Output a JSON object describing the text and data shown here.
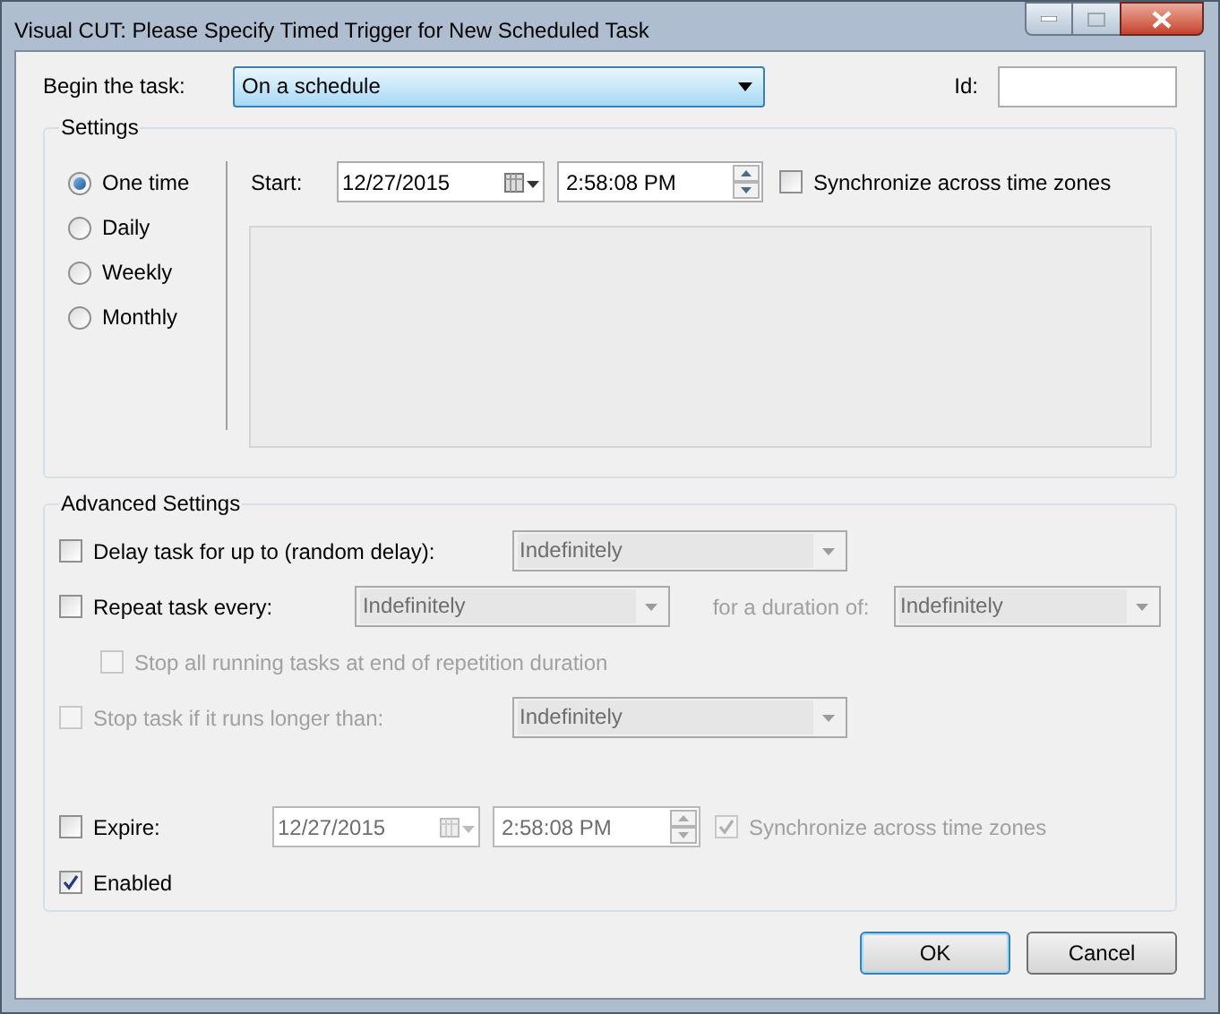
{
  "window": {
    "title": "Visual CUT: Please Specify Timed Trigger for New Scheduled Task"
  },
  "begin": {
    "label": "Begin the task:",
    "value": "On a schedule"
  },
  "id": {
    "label": "Id:"
  },
  "settings": {
    "title": "Settings",
    "schedules": [
      {
        "label": "One time",
        "selected": true
      },
      {
        "label": "Daily",
        "selected": false
      },
      {
        "label": "Weekly",
        "selected": false
      },
      {
        "label": "Monthly",
        "selected": false
      }
    ],
    "start": {
      "label": "Start:",
      "date": "12/27/2015",
      "time": "2:58:08 PM"
    },
    "sync": {
      "label": "Synchronize across time zones",
      "checked": false
    }
  },
  "advanced": {
    "title": "Advanced Settings",
    "delay": {
      "label": "Delay task for up to (random delay):",
      "checked": false,
      "disabled": false,
      "value": "Indefinitely"
    },
    "repeat": {
      "label": "Repeat task every:",
      "checked": false,
      "disabled": false,
      "value": "Indefinitely",
      "duration_label": "for a duration of:",
      "duration_value": "Indefinitely"
    },
    "stop_all": {
      "label": "Stop all running tasks at end of repetition duration",
      "checked": false,
      "disabled": true
    },
    "stop_task": {
      "label": "Stop task if it runs longer than:",
      "checked": false,
      "disabled": true,
      "value": "Indefinitely"
    },
    "expire": {
      "label": "Expire:",
      "checked": false,
      "disabled": false,
      "date": "12/27/2015",
      "time": "2:58:08 PM",
      "sync_label": "Synchronize across time zones",
      "sync_checked": true
    },
    "enabled": {
      "label": "Enabled",
      "checked": true,
      "disabled": false
    }
  },
  "buttons": [
    {
      "label": "OK",
      "default": true
    },
    {
      "label": "Cancel",
      "default": false
    }
  ]
}
